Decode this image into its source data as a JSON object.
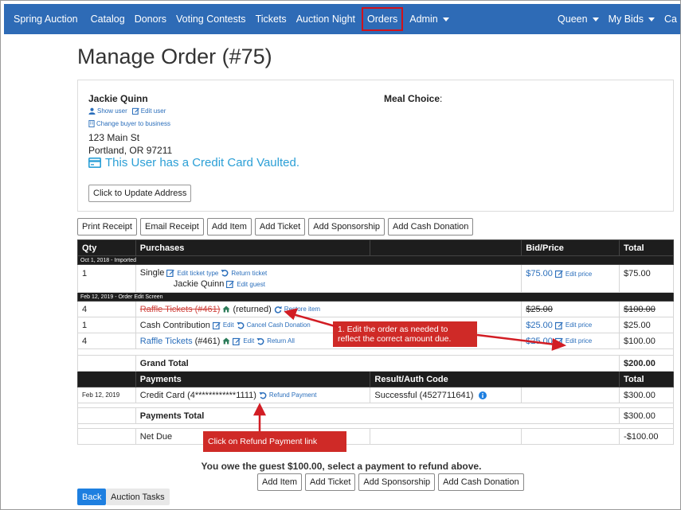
{
  "navbar": {
    "brand": "Spring Auction",
    "items": [
      "Catalog",
      "Donors",
      "Voting Contests",
      "Tickets",
      "Auction Night",
      "Orders",
      "Admin"
    ],
    "right_items": [
      "Queen",
      "My Bids",
      "Ca"
    ],
    "highlight_color": "#d0121b",
    "bg_color": "#2e6bb6"
  },
  "page_title": "Manage Order (#75)",
  "buyer": {
    "name": "Jackie Quinn",
    "show_user": "Show user",
    "edit_user": "Edit user",
    "change_buyer": "Change buyer to business",
    "address_line1": "123 Main St",
    "address_line2": "Portland, OR 97211",
    "cc_vaulted": "This User has a Credit Card Vaulted.",
    "update_address": "Click to Update Address",
    "meal_label": "Meal Choice",
    "meal_colon": ":"
  },
  "actions": [
    "Print Receipt",
    "Email Receipt",
    "Add Item",
    "Add Ticket",
    "Add Sponsorship",
    "Add Cash Donation"
  ],
  "table": {
    "headers": {
      "qty": "Qty",
      "purchases": "Purchases",
      "bid": "Bid/Price",
      "total": "Total"
    },
    "group1": "Oct 1, 2018 - Imported",
    "row1": {
      "qty": "1",
      "item": "Single",
      "edit_ticket_type": "Edit ticket type",
      "return_ticket": "Return ticket",
      "guest": "Jackie Quinn",
      "edit_guest": "Edit guest",
      "price": "$75.00",
      "edit_price": "Edit price",
      "total": "$75.00"
    },
    "group2": "Feb 12, 2019 - Order Edit Screen",
    "row2": {
      "qty": "4",
      "item": "Raffle Tickets (#461)",
      "status": "(returned)",
      "restore": "Restore item",
      "price": "$25.00",
      "total": "$100.00"
    },
    "row3": {
      "qty": "1",
      "item": "Cash Contribution",
      "edit": "Edit",
      "cancel": "Cancel Cash Donation",
      "price": "$25.00",
      "edit_price": "Edit price",
      "total": "$25.00"
    },
    "row4": {
      "qty": "4",
      "item": "Raffle Tickets",
      "item_num": "(#461)",
      "edit": "Edit",
      "return_all": "Return All",
      "price": "$25.00",
      "edit_price": "Edit price",
      "total": "$100.00"
    },
    "grand_total_label": "Grand Total",
    "grand_total": "$200.00",
    "payments_headers": {
      "payments": "Payments",
      "result": "Result/Auth Code",
      "total": "Total"
    },
    "payment1": {
      "date": "Feb 12, 2019",
      "method": "Credit Card (4************1111)",
      "refund": "Refund Payment",
      "result": "Successful (4527711641)",
      "total": "$300.00"
    },
    "payments_total_label": "Payments Total",
    "payments_total": "$300.00",
    "net_due_label": "Net Due",
    "net_due": "-$100.00"
  },
  "callouts": {
    "edit_order": "1.  Edit the order as needed to reflect the correct amount due.",
    "refund": "Click on Refund Payment link",
    "color": "#cf2a27"
  },
  "owe_message": "You owe the guest $100.00, select a payment to refund above.",
  "bottom_actions": [
    "Add Item",
    "Add Ticket",
    "Add Sponsorship",
    "Add Cash Donation"
  ],
  "footer": {
    "back": "Back",
    "tasks": "Auction Tasks"
  }
}
